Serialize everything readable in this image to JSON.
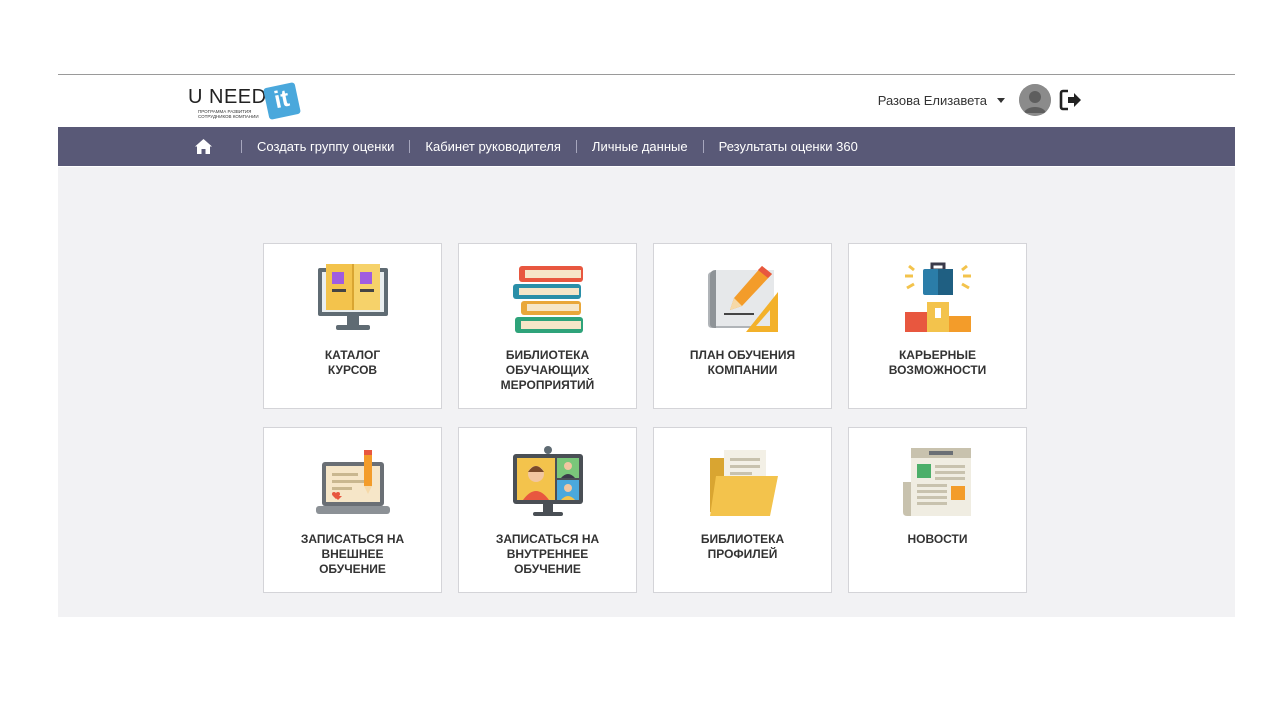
{
  "logo": {
    "text": "U NEED",
    "badge": "it",
    "subtitle": "ПРОГРАММА РАЗВИТИЯ СОТРУДНИКОВ КОМПАНИИ"
  },
  "user": {
    "name": "Разова Елизавета"
  },
  "nav": {
    "items": [
      "Создать группу оценки",
      "Кабинет руководителя",
      "Личные данные",
      "Результаты оценки 360"
    ]
  },
  "tiles": [
    {
      "label": "КАТАЛОГ\nКУРСОВ",
      "icon": "monitor-book-icon"
    },
    {
      "label": "БИБЛИОТЕКА\nОБУЧАЮЩИХ\nМЕРОПРИЯТИЙ",
      "icon": "books-stack-icon"
    },
    {
      "label": "ПЛАН ОБУЧЕНИЯ\nКОМПАНИИ",
      "icon": "blueprint-pencil-icon"
    },
    {
      "label": "КАРЬЕРНЫЕ\nВОЗМОЖНОСТИ",
      "icon": "briefcase-podium-icon"
    },
    {
      "label": "ЗАПИСАТЬСЯ НА\nВНЕШНЕЕ\nОБУЧЕНИЕ",
      "icon": "laptop-pencil-icon"
    },
    {
      "label": "ЗАПИСАТЬСЯ НА\nВНУТРЕННЕЕ\nОБУЧЕНИЕ",
      "icon": "video-conference-icon"
    },
    {
      "label": "БИБЛИОТЕКА\nПРОФИЛЕЙ",
      "icon": "folder-icon"
    },
    {
      "label": "НОВОСТИ",
      "icon": "newspaper-icon"
    }
  ],
  "colors": {
    "nav_bg": "#595977",
    "content_bg": "#f2f2f4",
    "logo_badge": "#4aa8dc"
  }
}
